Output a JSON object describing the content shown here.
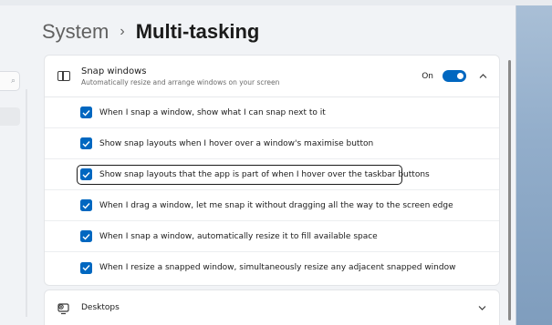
{
  "header": {
    "section": "System",
    "separator": "›",
    "title": "Multi-tasking"
  },
  "snap_panel": {
    "title": "Snap windows",
    "subtitle": "Automatically resize and arrange windows on your screen",
    "toggle_label": "On",
    "toggle_state": "on",
    "icon": "snap-windows-icon",
    "options": [
      {
        "label": "When I snap a window, show what I can snap next to it",
        "checked": true
      },
      {
        "label": "Show snap layouts when I hover over a window's maximise button",
        "checked": true
      },
      {
        "label": "Show snap layouts that the app is part of when I hover over the taskbar buttons",
        "checked": true,
        "focused": true
      },
      {
        "label": "When I drag a window, let me snap it without dragging all the way to the screen edge",
        "checked": true
      },
      {
        "label": "When I snap a window, automatically resize it to fill available space",
        "checked": true
      },
      {
        "label": "When I resize a snapped window, simultaneously resize any adjacent snapped window",
        "checked": true
      }
    ]
  },
  "desktops": {
    "label": "Desktops",
    "icon": "desktops-icon"
  },
  "colors": {
    "accent": "#0067c0",
    "background": "#f1f3f6",
    "card": "#ffffff",
    "text": "#1b1b1b"
  }
}
